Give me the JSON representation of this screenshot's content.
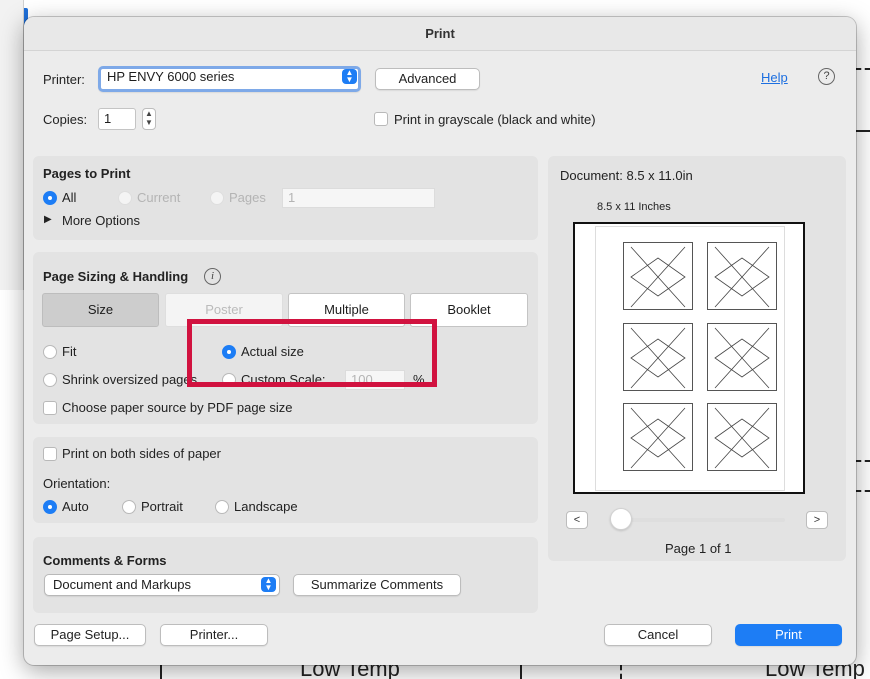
{
  "dialog": {
    "title": "Print"
  },
  "printer": {
    "label": "Printer:",
    "selected": "HP ENVY 6000 series",
    "advanced_label": "Advanced",
    "help_label": "Help",
    "help_icon": "?"
  },
  "copies": {
    "label": "Copies:",
    "value": "1",
    "grayscale_label": "Print in grayscale (black and white)"
  },
  "pages_to_print": {
    "title": "Pages to Print",
    "all_label": "All",
    "current_label": "Current",
    "pages_label": "Pages",
    "pages_value": "1",
    "more_options_label": "More Options"
  },
  "page_sizing": {
    "title": "Page Sizing & Handling",
    "info_icon": "i",
    "tabs": [
      "Size",
      "Poster",
      "Multiple",
      "Booklet"
    ],
    "fit_label": "Fit",
    "actual_size_label": "Actual size",
    "shrink_label": "Shrink oversized pages",
    "custom_scale_label": "Custom Scale:",
    "custom_scale_value": "100",
    "percent_label": "%",
    "paper_source_label": "Choose paper source by PDF page size"
  },
  "duplex": {
    "both_sides_label": "Print on both sides of paper",
    "orientation_label": "Orientation:",
    "auto_label": "Auto",
    "portrait_label": "Portrait",
    "landscape_label": "Landscape"
  },
  "comments": {
    "title": "Comments & Forms",
    "selected": "Document and Markups",
    "summarize_label": "Summarize Comments"
  },
  "preview": {
    "document_size": "Document: 8.5 x 11.0in",
    "page_size_caption": "8.5 x 11 Inches",
    "prev_label": "<",
    "next_label": ">",
    "page_indicator": "Page 1 of 1"
  },
  "footer": {
    "page_setup_label": "Page Setup...",
    "printer_label": "Printer...",
    "cancel_label": "Cancel",
    "print_label": "Print"
  },
  "background": {
    "text_left": "Low Temp",
    "text_right": "Low Temp"
  },
  "colors": {
    "accent": "#1d7df5",
    "highlight": "#d1123f"
  }
}
